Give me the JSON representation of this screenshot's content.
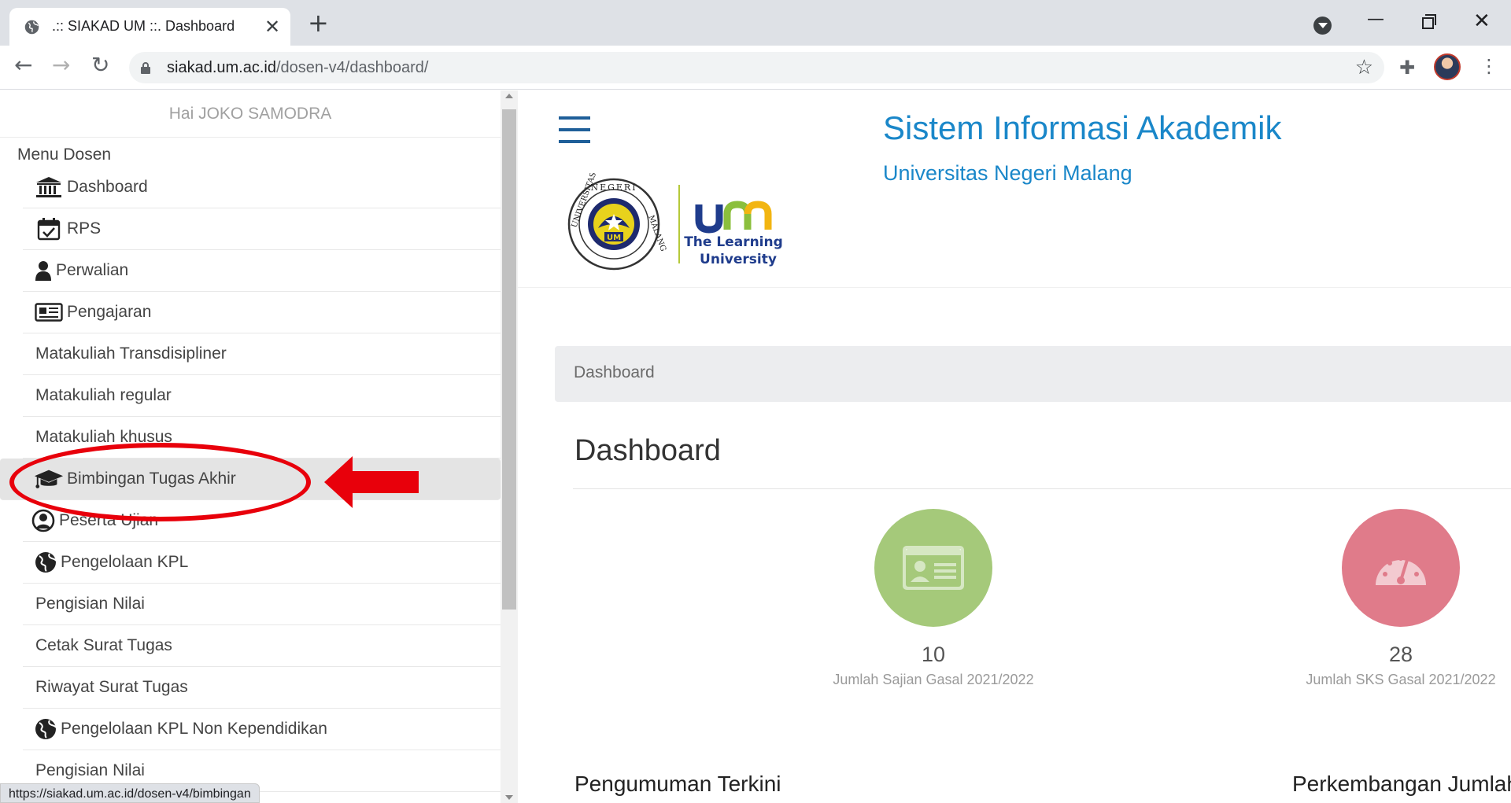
{
  "browser": {
    "tab_title": ".:: SIAKAD UM ::. Dashboard",
    "url_host": "siakad.um.ac.id",
    "url_path": "/dosen-v4/dashboard/",
    "status_url": "https://siakad.um.ac.id/dosen-v4/bimbingan"
  },
  "sidebar": {
    "greeting": "Hai JOKO SAMODRA",
    "menu_heading": "Menu Dosen",
    "items": [
      {
        "label": "Dashboard",
        "icon": "bank-icon"
      },
      {
        "label": "RPS",
        "icon": "calendar-check-icon"
      },
      {
        "label": "Perwalian",
        "icon": "user-icon"
      },
      {
        "label": "Pengajaran",
        "icon": "newspaper-icon"
      },
      {
        "label": "Matakuliah Transdisipliner",
        "icon": ""
      },
      {
        "label": "Matakuliah regular",
        "icon": ""
      },
      {
        "label": "Matakuliah khusus",
        "icon": ""
      },
      {
        "label": "Bimbingan Tugas Akhir",
        "icon": "graduation-cap-icon"
      },
      {
        "label": "Peserta Ujian",
        "icon": "user-circle-icon"
      },
      {
        "label": "Pengelolaan KPL",
        "icon": "globe-icon"
      },
      {
        "label": "Pengisian Nilai",
        "icon": ""
      },
      {
        "label": "Cetak Surat Tugas",
        "icon": ""
      },
      {
        "label": "Riwayat Surat Tugas",
        "icon": ""
      },
      {
        "label": "Pengelolaan KPL Non Kependidikan",
        "icon": "globe-icon"
      },
      {
        "label": "Pengisian Nilai",
        "icon": ""
      }
    ]
  },
  "header": {
    "title": "Sistem Informasi Akademik",
    "subtitle": "Universitas Negeri Malang",
    "logo_text_line1": "The Learning",
    "logo_text_line2": "University",
    "logo_um": "um"
  },
  "breadcrumb": "Dashboard",
  "page_title": "Dashboard",
  "stats": [
    {
      "value": "10",
      "label": "Jumlah Sajian Gasal 2021/2022",
      "color": "#a5c97a",
      "icon": "id-card-icon"
    },
    {
      "value": "28",
      "label": "Jumlah SKS Gasal 2021/2022",
      "color": "#e07b8a",
      "icon": "speedometer-icon"
    }
  ],
  "sections": {
    "announcements": "Pengumuman Terkini",
    "progress": "Perkembangan Jumlah S"
  },
  "colors": {
    "accent": "#1a87c9",
    "annotation": "#e8000b"
  }
}
